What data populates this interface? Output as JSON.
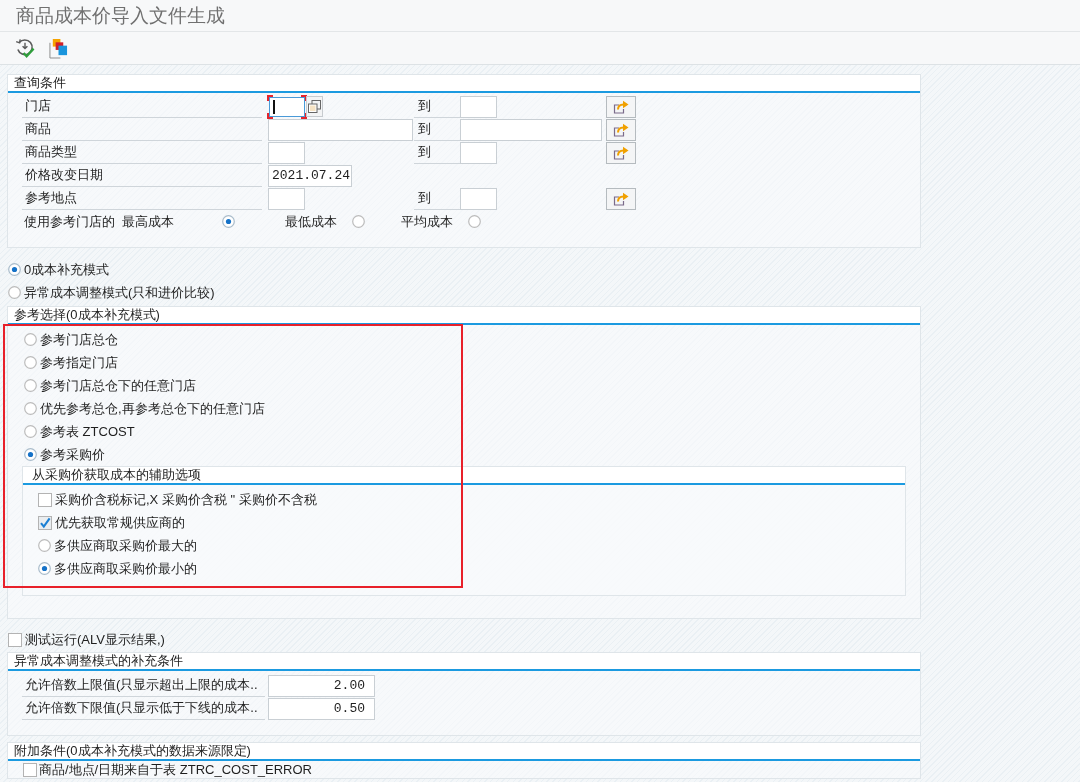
{
  "window": {
    "title": "商品成本价导入文件生成"
  },
  "query_conditions": {
    "title": "查询条件",
    "fields": [
      {
        "label": "门店",
        "kind": "range",
        "focused": true,
        "to_label": "到"
      },
      {
        "label": "商品",
        "kind": "longrange",
        "focused": false,
        "to_label": "到"
      },
      {
        "label": "商品类型",
        "kind": "range",
        "focused": false,
        "to_label": "到"
      },
      {
        "label": "价格改变日期",
        "kind": "date",
        "focused": false,
        "value": "2021.07.24"
      },
      {
        "label": "参考地点",
        "kind": "range",
        "focused": false,
        "to_label": "到"
      }
    ],
    "cost_basis": {
      "label": "使用参考门店的",
      "options": [
        {
          "label": "最高成本",
          "selected": true
        },
        {
          "label": "最低成本",
          "selected": false
        },
        {
          "label": "平均成本",
          "selected": false
        }
      ]
    }
  },
  "modes": [
    {
      "label": "0成本补充模式",
      "selected": true
    },
    {
      "label": "异常成本调整模式(只和进价比较)",
      "selected": false
    }
  ],
  "reference_selection": {
    "title": "参考选择(0成本补充模式)",
    "highlighted": true,
    "options": [
      {
        "label": "参考门店总仓",
        "selected": false
      },
      {
        "label": "参考指定门店",
        "selected": false
      },
      {
        "label": "参考门店总仓下的任意门店",
        "selected": false
      },
      {
        "label": "优先参考总仓,再参考总仓下的任意门店",
        "selected": false
      },
      {
        "label": "参考表 ZTCOST",
        "selected": false
      },
      {
        "label": "参考采购价",
        "selected": true
      }
    ],
    "purchase_price_options": {
      "title": "从采购价获取成本的辅助选项",
      "items": [
        {
          "kind": "checkbox",
          "label": "采购价含税标记,X 采购价含税 \" 采购价不含税",
          "checked": false
        },
        {
          "kind": "checkbox",
          "label": "优先获取常规供应商的",
          "checked": true
        },
        {
          "kind": "radio",
          "label": "多供应商取采购价最大的",
          "selected": false
        },
        {
          "kind": "radio",
          "label": "多供应商取采购价最小的",
          "selected": true
        }
      ]
    }
  },
  "test_run": {
    "label": "测试运行(ALV显示结果,)",
    "checked": false
  },
  "adjustment_conditions": {
    "title": "异常成本调整模式的补充条件",
    "fields": [
      {
        "label": "允许倍数上限值(只显示超出上限的成本..",
        "value": "2.00"
      },
      {
        "label": "允许倍数下限值(只显示低于下线的成本..",
        "value": "0.50"
      }
    ]
  },
  "additional_conditions": {
    "title": "附加条件(0成本补充模式的数据来源限定)",
    "items": [
      {
        "label": "商品/地点/日期来自于表 ZTRC_COST_ERROR",
        "checked": false
      }
    ]
  }
}
